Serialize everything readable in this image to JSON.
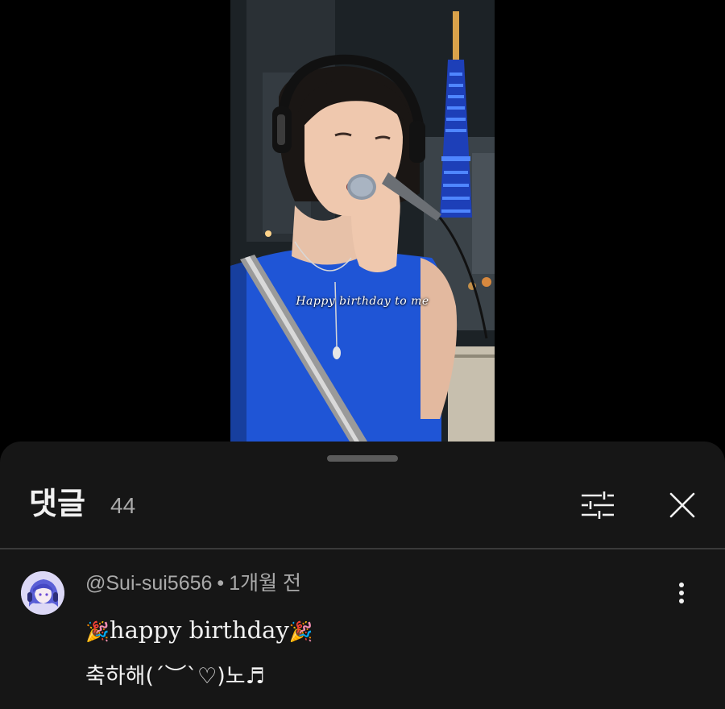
{
  "video": {
    "caption": "Happy birthday to me"
  },
  "comments_panel": {
    "title": "댓글",
    "count": "44",
    "filter_icon": "sliders-icon",
    "close_icon": "close-icon"
  },
  "comment": {
    "author": "@Sui-sui5656",
    "separator": "•",
    "time": "1개월 전",
    "line1_emoji_left": "🎉",
    "line1_text": "happy birthday",
    "line1_emoji_right": "🎉",
    "line2_text": "축하해(´︶`♡)노♬",
    "more_icon": "more-vertical-icon"
  },
  "colors": {
    "sheet_bg": "#161616",
    "primary_text": "#f1f1f1",
    "secondary_text": "#aaaaaa",
    "shirt_blue": "#1f55d6",
    "tower_blue": "#3a6cff"
  }
}
